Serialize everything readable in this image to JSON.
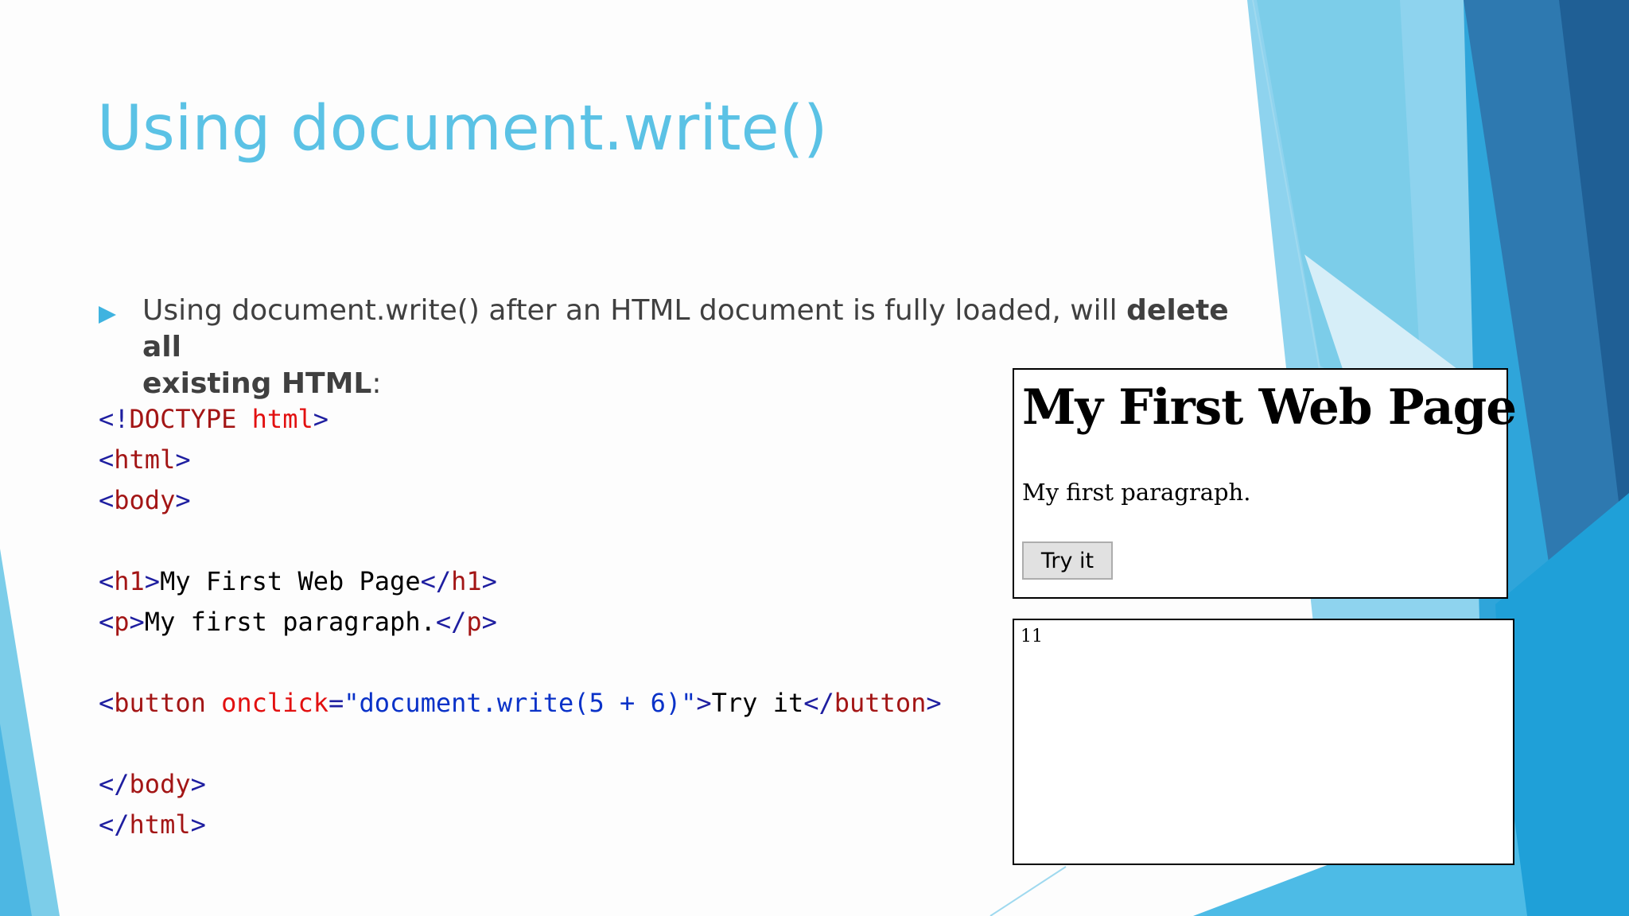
{
  "slide": {
    "title": "Using document.write()",
    "bullet": {
      "text_plain": "Using document.write() after an HTML document is fully loaded, will ",
      "text_bold_1": "delete all",
      "text_bold_2": "existing HTML",
      "text_end": ":"
    }
  },
  "code_lines": [
    [
      {
        "c": "tag",
        "t": "<!"
      },
      {
        "c": "name",
        "t": "DOCTYPE"
      },
      {
        "c": "txt",
        "t": " "
      },
      {
        "c": "attr",
        "t": "html"
      },
      {
        "c": "tag",
        "t": ">"
      }
    ],
    [
      {
        "c": "tag",
        "t": "<"
      },
      {
        "c": "name",
        "t": "html"
      },
      {
        "c": "tag",
        "t": ">"
      }
    ],
    [
      {
        "c": "tag",
        "t": "<"
      },
      {
        "c": "name",
        "t": "body"
      },
      {
        "c": "tag",
        "t": ">"
      }
    ],
    [],
    [
      {
        "c": "tag",
        "t": "<"
      },
      {
        "c": "name",
        "t": "h1"
      },
      {
        "c": "tag",
        "t": ">"
      },
      {
        "c": "txt",
        "t": "My First Web Page"
      },
      {
        "c": "tag",
        "t": "</"
      },
      {
        "c": "name",
        "t": "h1"
      },
      {
        "c": "tag",
        "t": ">"
      }
    ],
    [
      {
        "c": "tag",
        "t": "<"
      },
      {
        "c": "name",
        "t": "p"
      },
      {
        "c": "tag",
        "t": ">"
      },
      {
        "c": "txt",
        "t": "My first paragraph."
      },
      {
        "c": "tag",
        "t": "</"
      },
      {
        "c": "name",
        "t": "p"
      },
      {
        "c": "tag",
        "t": ">"
      }
    ],
    [],
    [
      {
        "c": "tag",
        "t": "<"
      },
      {
        "c": "name",
        "t": "button"
      },
      {
        "c": "txt",
        "t": " "
      },
      {
        "c": "attr",
        "t": "onclick"
      },
      {
        "c": "tag",
        "t": "="
      },
      {
        "c": "str",
        "t": "\"document.write(5 + 6)\""
      },
      {
        "c": "tag",
        "t": ">"
      },
      {
        "c": "txt",
        "t": "Try it"
      },
      {
        "c": "tag",
        "t": "</"
      },
      {
        "c": "name",
        "t": "button"
      },
      {
        "c": "tag",
        "t": ">"
      }
    ],
    [],
    [
      {
        "c": "tag",
        "t": "</"
      },
      {
        "c": "name",
        "t": "body"
      },
      {
        "c": "tag",
        "t": ">"
      }
    ],
    [
      {
        "c": "tag",
        "t": "</"
      },
      {
        "c": "name",
        "t": "html"
      },
      {
        "c": "tag",
        "t": ">"
      }
    ]
  ],
  "browser_before": {
    "heading": "My First Web Page",
    "paragraph": "My first paragraph.",
    "button_label": "Try it"
  },
  "browser_after": {
    "output": "11"
  },
  "colors": {
    "title": "#5bc2e5",
    "body_text": "#404040",
    "bullet": "#3fb3e0",
    "code_tag": "#1e1ea0",
    "code_name": "#a31515",
    "code_attr": "#e21010",
    "code_string": "#0a32c8"
  },
  "icons": {
    "bullet": "triangle-right-icon"
  }
}
